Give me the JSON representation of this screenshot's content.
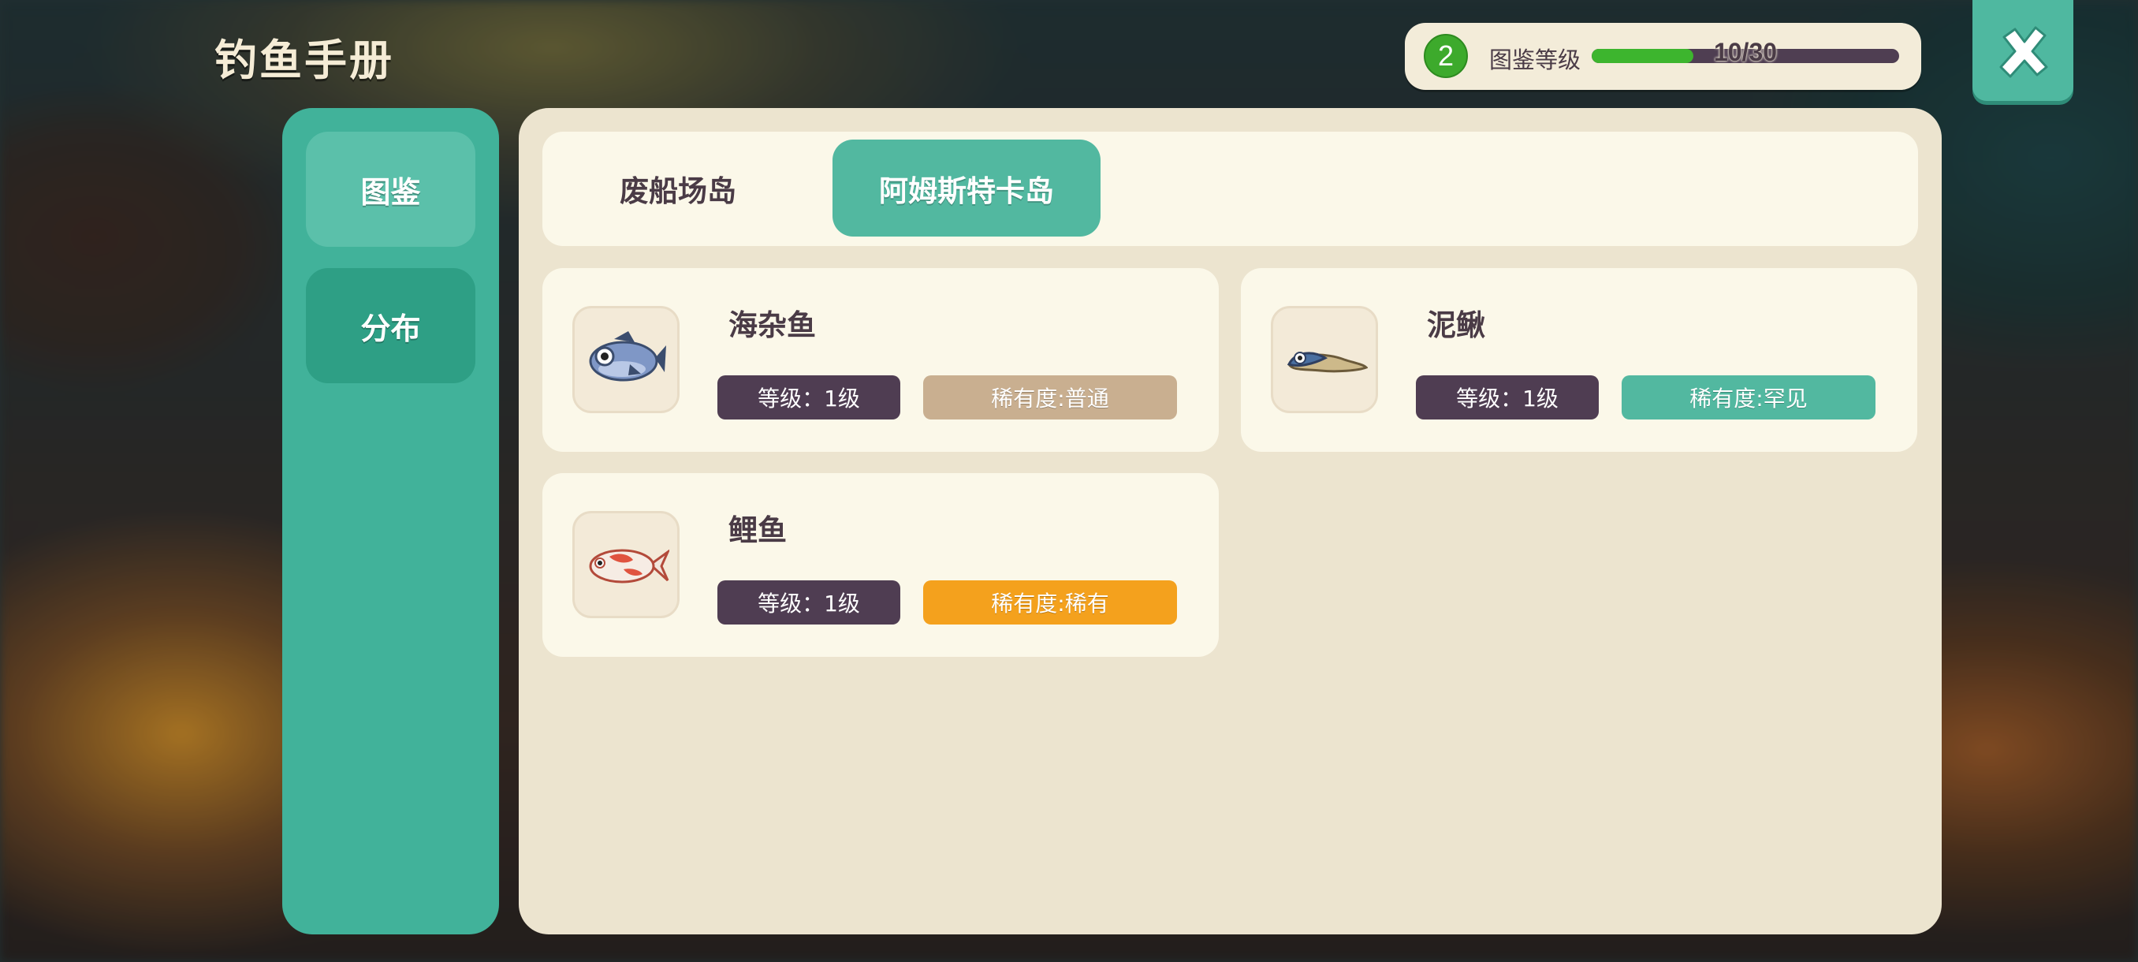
{
  "title": "钓鱼手册",
  "level_panel": {
    "level": "2",
    "label": "图鉴等级",
    "progress_text": "10/30",
    "progress_fraction": 0.33
  },
  "close_icon": "close-x-icon",
  "sidebar": {
    "items": [
      {
        "label": "图鉴"
      },
      {
        "label": "分布"
      }
    ]
  },
  "island_tabs": [
    {
      "label": "废船场岛"
    },
    {
      "label": "阿姆斯特卡岛"
    }
  ],
  "fish": [
    {
      "name": "海杂鱼",
      "level": "等级：1级",
      "rarity": "稀有度:普通",
      "rarity_color": "#c9af90",
      "icon": "blue-fish-icon"
    },
    {
      "name": "泥鳅",
      "level": "等级：1级",
      "rarity": "稀有度:罕见",
      "rarity_color": "#52b8a0",
      "icon": "loach-icon"
    },
    {
      "name": "鲤鱼",
      "level": "等级：1级",
      "rarity": "稀有度:稀有",
      "rarity_color": "#f4a11d",
      "icon": "koi-fish-icon"
    }
  ],
  "colors": {
    "accent": "#41b29a",
    "panel": "#ece4cf",
    "card": "#fbf8e9",
    "dark_pill": "#4f3d52",
    "progress_fill": "#3db52e"
  }
}
